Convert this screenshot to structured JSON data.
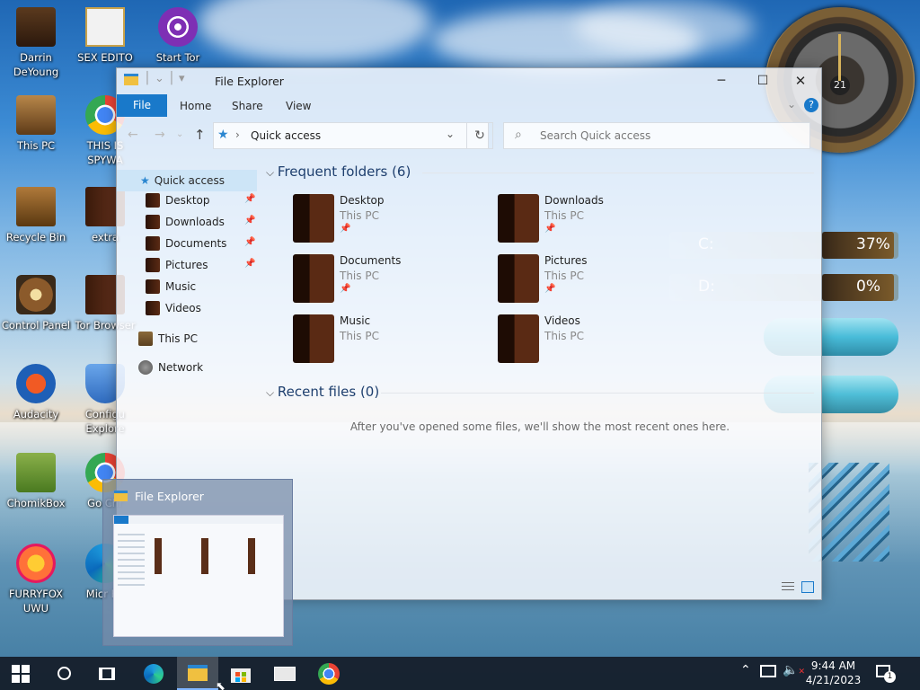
{
  "desktop_icons": [
    {
      "label": "Darrin DeYoung",
      "icon": "user-folder-icon"
    },
    {
      "label": "SEX EDITO",
      "icon": "hxd-editor-icon"
    },
    {
      "label": "Start Tor",
      "icon": "tor-icon"
    },
    {
      "label": "This PC",
      "icon": "computer-icon"
    },
    {
      "label": "THIS IS SPYWA",
      "icon": "chrome-icon"
    },
    {
      "label": "Recycle Bin",
      "icon": "recycle-bin-icon"
    },
    {
      "label": "extra",
      "icon": "folder-icon"
    },
    {
      "label": "Control Panel",
      "icon": "control-panel-icon"
    },
    {
      "label": "Tor Browser",
      "icon": "tor-folder-icon"
    },
    {
      "label": "Audacity",
      "icon": "audacity-icon"
    },
    {
      "label": "Configu Explore",
      "icon": "shield-icon"
    },
    {
      "label": "ChomikBox",
      "icon": "chomikbox-icon"
    },
    {
      "label": "Go Chr",
      "icon": "chrome-icon"
    },
    {
      "label": "FURRYFOX UWU",
      "icon": "firefox-icon"
    },
    {
      "label": "Micr Ed",
      "icon": "edge-icon"
    }
  ],
  "widgets": {
    "clock_day": "21",
    "drive_c_label": "C:",
    "drive_c_percent": "37%",
    "drive_d_label": "D:",
    "drive_d_percent": "0%"
  },
  "explorer": {
    "title": "File Explorer",
    "ribbon_tabs": [
      "File",
      "Home",
      "Share",
      "View"
    ],
    "address": "Quick access",
    "search_placeholder": "Search Quick access",
    "nav": {
      "quick_access": "Quick access",
      "items": [
        "Desktop",
        "Downloads",
        "Documents",
        "Pictures",
        "Music",
        "Videos"
      ],
      "this_pc": "This PC",
      "network": "Network"
    },
    "frequent_header": "Frequent folders (6)",
    "folders": [
      {
        "name": "Desktop",
        "location": "This PC",
        "pinned": true
      },
      {
        "name": "Downloads",
        "location": "This PC",
        "pinned": true
      },
      {
        "name": "Documents",
        "location": "This PC",
        "pinned": true
      },
      {
        "name": "Pictures",
        "location": "This PC",
        "pinned": true
      },
      {
        "name": "Music",
        "location": "This PC",
        "pinned": false
      },
      {
        "name": "Videos",
        "location": "This PC",
        "pinned": false
      }
    ],
    "recent_header": "Recent files (0)",
    "recent_empty": "After you've opened some files, we'll show the most recent ones here."
  },
  "thumbnail_title": "File Explorer",
  "taskbar": {
    "time": "9:44 AM",
    "date": "4/21/2023",
    "notification_count": "1"
  }
}
